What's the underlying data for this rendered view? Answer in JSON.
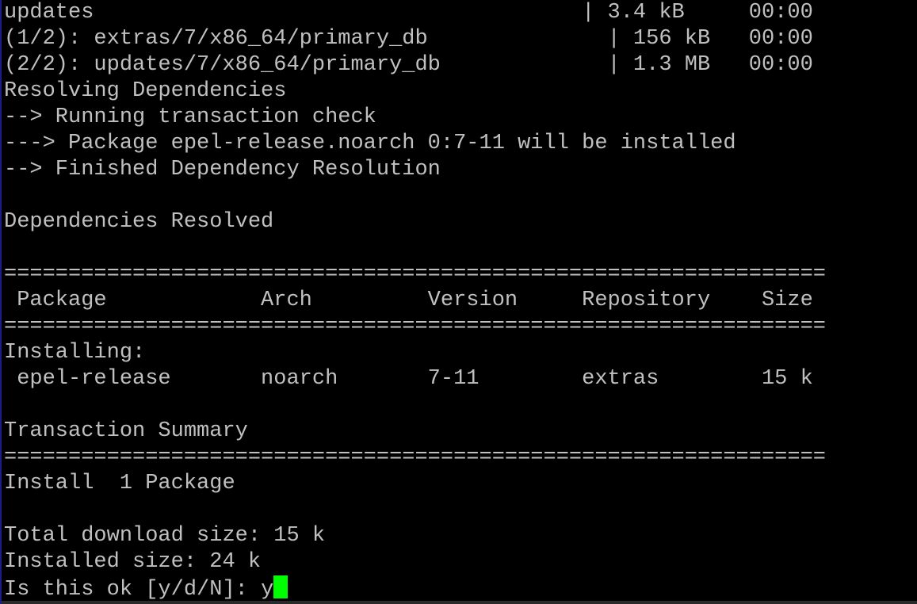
{
  "terminal": {
    "colors": {
      "background": "#000000",
      "foreground": "#c0c0c0",
      "cursor": "#00ff00"
    },
    "lines": [
      "updates                                      | 3.4 kB     00:00",
      "(1/2): extras/7/x86_64/primary_db              | 156 kB   00:00",
      "(2/2): updates/7/x86_64/primary_db             | 1.3 MB   00:00",
      "Resolving Dependencies",
      "--> Running transaction check",
      "---> Package epel-release.noarch 0:7-11 will be installed",
      "--> Finished Dependency Resolution",
      "",
      "Dependencies Resolved",
      "",
      "================================================================",
      " Package            Arch         Version     Repository    Size",
      "================================================================",
      "Installing:",
      " epel-release       noarch       7-11        extras        15 k",
      "",
      "Transaction Summary",
      "================================================================",
      "Install  1 Package",
      "",
      "Total download size: 15 k",
      "Installed size: 24 k"
    ],
    "prompt": "Is this ok [y/d/N]: ",
    "input": "y"
  }
}
